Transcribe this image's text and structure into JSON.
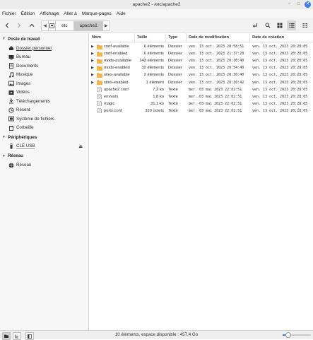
{
  "window": {
    "title": "apache2 - /etc/apache2"
  },
  "menu": [
    "Fichier",
    "Édition",
    "Affichage",
    "Aller à",
    "Marque-pages",
    "Aide"
  ],
  "breadcrumb": {
    "items": [
      "etc",
      "apache2"
    ]
  },
  "sidebar": {
    "sections": [
      {
        "label": "Poste de travail",
        "items": [
          {
            "label": "Dossier personnel",
            "icon": "home-icon"
          },
          {
            "label": "Bureau",
            "icon": "desktop-icon"
          },
          {
            "label": "Documents",
            "icon": "documents-icon"
          },
          {
            "label": "Musique",
            "icon": "music-icon"
          },
          {
            "label": "Images",
            "icon": "pictures-icon"
          },
          {
            "label": "Vidéos",
            "icon": "videos-icon"
          },
          {
            "label": "Téléchargements",
            "icon": "download-icon"
          },
          {
            "label": "Récent",
            "icon": "recent-icon"
          },
          {
            "label": "Système de fichiers",
            "icon": "drive-icon"
          },
          {
            "label": "Corbeille",
            "icon": "trash-icon"
          }
        ]
      },
      {
        "label": "Périphériques",
        "items": [
          {
            "label": "CLÉ USB",
            "icon": "usb-icon"
          }
        ]
      },
      {
        "label": "Réseau",
        "items": [
          {
            "label": "Réseau",
            "icon": "network-icon"
          }
        ]
      }
    ]
  },
  "table": {
    "columns": [
      "Nom",
      "Taille",
      "Type",
      "Date de modification",
      "Date de création"
    ],
    "rows": [
      {
        "name": "conf-available",
        "size": "6 éléments",
        "type": "Dossier",
        "modified": "ven. 13 oct. 2023 20:58:51",
        "created": "ven. 13 oct. 2023 20:28:05",
        "folder": true
      },
      {
        "name": "conf-enabled",
        "size": "6 éléments",
        "type": "Dossier",
        "modified": "ven. 13 oct. 2023 21:37:28",
        "created": "ven. 13 oct. 2023 20:28:05",
        "folder": true
      },
      {
        "name": "mods-available",
        "size": "143 éléments",
        "type": "Dossier",
        "modified": "ven. 13 oct. 2023 20:30:40",
        "created": "ven. 13 oct. 2023 20:28:05",
        "folder": true
      },
      {
        "name": "mods-enabled",
        "size": "32 éléments",
        "type": "Dossier",
        "modified": "ven. 13 oct. 2023 20:54:40",
        "created": "ven. 13 oct. 2023 20:28:05",
        "folder": true
      },
      {
        "name": "sites-available",
        "size": "2 éléments",
        "type": "Dossier",
        "modified": "ven. 13 oct. 2023 20:30:40",
        "created": "ven. 13 oct. 2023 20:28:05",
        "folder": true
      },
      {
        "name": "sites-enabled",
        "size": "1 élément",
        "type": "Dossier",
        "modified": "ven. 13 oct. 2023 20:30:42",
        "created": "ven. 13 oct. 2023 20:28:05",
        "folder": true
      },
      {
        "name": "apache2.conf",
        "size": "7,2 ko",
        "type": "Texte",
        "modified": "mer. 03 mai 2023 22:02:51",
        "created": "ven. 13 oct. 2023 20:28:05",
        "folder": false
      },
      {
        "name": "envvars",
        "size": "1,8 ko",
        "type": "Texte",
        "modified": "mer. 03 mai 2023 22:02:51",
        "created": "ven. 13 oct. 2023 20:28:05",
        "folder": false
      },
      {
        "name": "magic",
        "size": "31,1 ko",
        "type": "Texte",
        "modified": "mer. 03 mai 2023 22:02:51",
        "created": "ven. 13 oct. 2023 20:28:05",
        "folder": false
      },
      {
        "name": "ports.conf",
        "size": "320 octets",
        "type": "Texte",
        "modified": "mer. 03 mai 2023 22:02:51",
        "created": "ven. 13 oct. 2023 20:28:05",
        "folder": false
      }
    ]
  },
  "status": {
    "text": "10 éléments, espace disponible : 457,4 Go",
    "zoom_fraction": 0.2
  },
  "colors": {
    "accent": "#3d7be0",
    "folder": "#e8a33c",
    "selected_crumb": "#c9c9c9"
  }
}
